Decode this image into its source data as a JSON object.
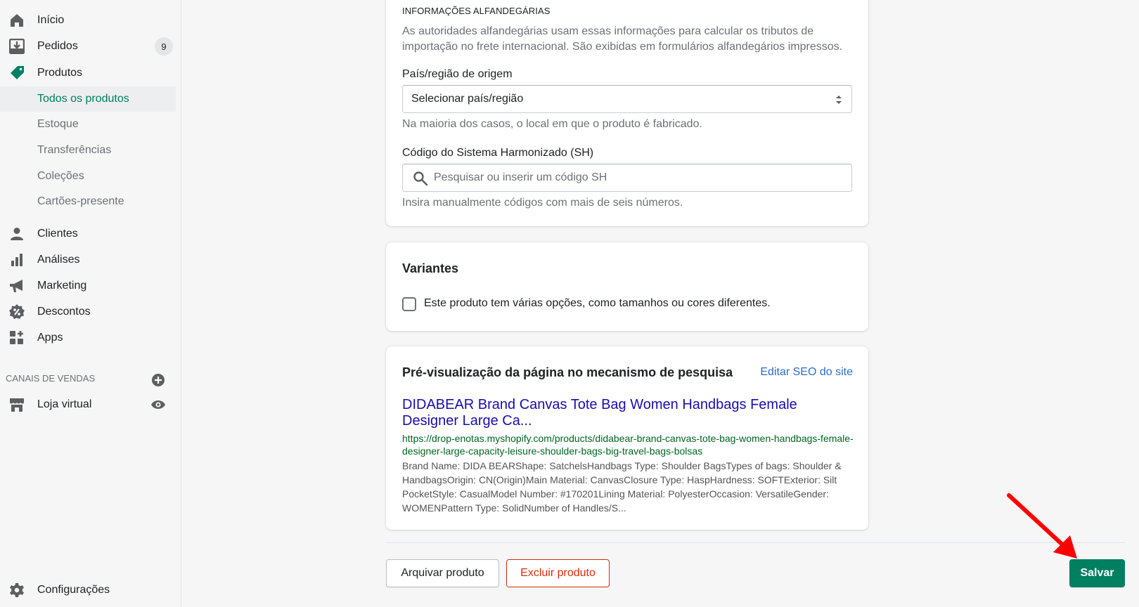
{
  "sidebar": {
    "nav": {
      "home": "Início",
      "orders": "Pedidos",
      "orders_badge": "9",
      "products": "Produtos",
      "customers": "Clientes",
      "analytics": "Análises",
      "marketing": "Marketing",
      "discounts": "Descontos",
      "apps": "Apps"
    },
    "products_sub": {
      "all": "Todos os produtos",
      "inventory": "Estoque",
      "transfers": "Transferências",
      "collections": "Coleções",
      "gift_cards": "Cartões-presente"
    },
    "sales_channels_title": "CANAIS DE VENDAS",
    "online_store": "Loja virtual",
    "settings": "Configurações"
  },
  "customs": {
    "title": "INFORMAÇÕES ALFANDEGÁRIAS",
    "description": "As autoridades alfandegárias usam essas informações para calcular os tributos de importação no frete internacional. São exibidas em formulários alfandegários impressos.",
    "origin_label": "País/região de origem",
    "origin_value": "Selecionar país/região",
    "origin_help": "Na maioria dos casos, o local em que o produto é fabricado.",
    "hs_label": "Código do Sistema Harmonizado (SH)",
    "hs_placeholder": "Pesquisar ou inserir um código SH",
    "hs_help": "Insira manualmente códigos com mais de seis números."
  },
  "variants": {
    "title": "Variantes",
    "checkbox_label": "Este produto tem várias opções, como tamanhos ou cores diferentes."
  },
  "seo": {
    "title": "Pré-visualização da página no mecanismo de pesquisa",
    "edit_link": "Editar SEO do site",
    "preview_title": "DIDABEAR Brand Canvas Tote Bag Women Handbags Female Designer Large Ca...",
    "preview_url": "https://drop-enotas.myshopify.com/products/didabear-brand-canvas-tote-bag-women-handbags-female-designer-large-capacity-leisure-shoulder-bags-big-travel-bags-bolsas",
    "preview_description": "Brand Name: DIDA BEARShape: SatchelsHandbags Type: Shoulder BagsTypes of bags: Shoulder & HandbagsOrigin: CN(Origin)Main Material: CanvasClosure Type: HaspHardness: SOFTExterior: Silt PocketStyle: CasualModel Number: #170201Lining Material: PolyesterOccasion: VersatileGender: WOMENPattern Type: SolidNumber of Handles/S..."
  },
  "footer": {
    "archive": "Arquivar produto",
    "delete": "Excluir produto",
    "save": "Salvar"
  },
  "colors": {
    "primary": "#008060",
    "critical": "#d82c0d",
    "annotation_arrow": "#ff0000"
  }
}
